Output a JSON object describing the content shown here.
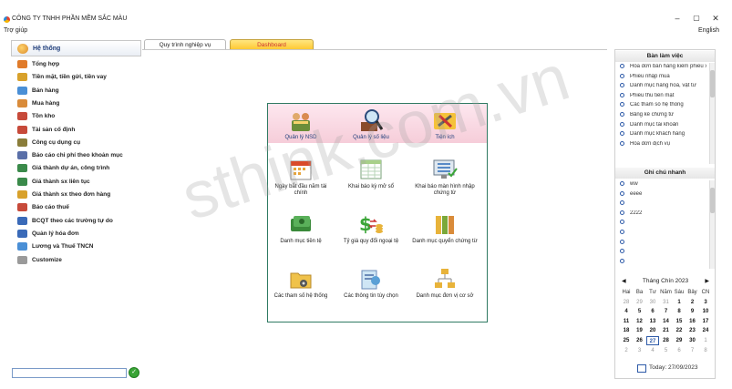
{
  "window": {
    "title": "CÔNG TY TNHH PHẦN MỀM SẮC MÀU",
    "menu_help": "Trợ giúp",
    "language": "English",
    "minimize": "–",
    "maximize": "▢",
    "close": "✕"
  },
  "sidebar": {
    "header": "Hệ thống",
    "items": [
      {
        "label": "Tổng hợp",
        "color": "#e07b2a"
      },
      {
        "label": "Tiền mặt, tiền gửi, tiền vay",
        "color": "#d8a12b"
      },
      {
        "label": "Bán hàng",
        "color": "#4a8fd6"
      },
      {
        "label": "Mua hàng",
        "color": "#d98b3a"
      },
      {
        "label": "Tồn kho",
        "color": "#c74a3a"
      },
      {
        "label": "Tài sản cố định",
        "color": "#c74a3a"
      },
      {
        "label": "Công cụ dụng cụ",
        "color": "#8a7d3a"
      },
      {
        "label": "Báo cáo chi phí theo khoản mục",
        "color": "#5a6fa8"
      },
      {
        "label": "Giá thành dự án, công trình",
        "color": "#3a8a4a"
      },
      {
        "label": "Giá thành sx liên tục",
        "color": "#3a8a4a"
      },
      {
        "label": "Giá thành sx theo đơn hàng",
        "color": "#d8a12b"
      },
      {
        "label": "Báo cáo thuế",
        "color": "#c74a3a"
      },
      {
        "label": "BCQT theo các trường tự do",
        "color": "#3a6ab8"
      },
      {
        "label": "Quản lý hóa đơn",
        "color": "#3a6ab8"
      },
      {
        "label": "Lương và Thuế TNCN",
        "color": "#4a8fd6"
      },
      {
        "label": "Customize",
        "color": "#9a9a9a"
      }
    ],
    "search_value": "",
    "go_icon": "✓"
  },
  "tabs": [
    {
      "label": "Quy trình nghiệp vụ",
      "active": true
    },
    {
      "label": "Dashboard",
      "active": false
    }
  ],
  "workflow": [
    {
      "label": "Quản lý NSD",
      "icon": "users-icon"
    },
    {
      "label": "Quản lý số liệu",
      "icon": "magnifier-icon"
    },
    {
      "label": "Tiện ích",
      "icon": "tools-icon"
    },
    {
      "label": "Ngày bắt đầu năm tài chính",
      "icon": "calendar-icon"
    },
    {
      "label": "Khai báo kỳ mở sổ",
      "icon": "spreadsheet-icon"
    },
    {
      "label": "Khai báo màn hình nhập chứng từ",
      "icon": "monitor-checklist-icon"
    },
    {
      "label": "Danh mục tiền tệ",
      "icon": "money-icon"
    },
    {
      "label": "Tỷ giá quy đổi ngoại tệ",
      "icon": "exchange-rate-icon"
    },
    {
      "label": "Danh mục quyển chứng từ",
      "icon": "binders-icon"
    },
    {
      "label": "Các tham số hệ thống",
      "icon": "folder-gear-icon"
    },
    {
      "label": "Các thông tin tùy chọn",
      "icon": "options-icon"
    },
    {
      "label": "Danh mục đơn vị cơ sở",
      "icon": "network-icon"
    }
  ],
  "right_panel": {
    "desk_title": "Bàn làm việc",
    "desk_items": [
      "Hóa đơn bán hàng kiêm phiếu xuất",
      "Phiếu nhập mua",
      "Danh mục hàng hoá, vật tư",
      "Phiếu thu tiền mặt",
      "Các tham số hệ thống",
      "Bảng kê chứng từ",
      "Danh mục tài khoản",
      "Danh mục khách hàng",
      "Hóa đơn dịch vụ"
    ],
    "notes_title": "Ghi chú nhanh",
    "notes_items": [
      "ww",
      "eeee",
      "",
      "2222",
      "",
      "",
      "",
      "",
      ""
    ]
  },
  "calendar": {
    "month_label": "Tháng Chín 2023",
    "prev": "◀",
    "next": "▶",
    "dow": [
      "Hai",
      "Ba",
      "Tư",
      "Năm",
      "Sáu",
      "Bảy",
      "CN"
    ],
    "weeks": [
      [
        {
          "d": "28",
          "o": 1
        },
        {
          "d": "29",
          "o": 1
        },
        {
          "d": "30",
          "o": 1
        },
        {
          "d": "31",
          "o": 1
        },
        {
          "d": "1"
        },
        {
          "d": "2"
        },
        {
          "d": "3"
        }
      ],
      [
        {
          "d": "4"
        },
        {
          "d": "5"
        },
        {
          "d": "6"
        },
        {
          "d": "7"
        },
        {
          "d": "8"
        },
        {
          "d": "9"
        },
        {
          "d": "10"
        }
      ],
      [
        {
          "d": "11"
        },
        {
          "d": "12"
        },
        {
          "d": "13"
        },
        {
          "d": "14"
        },
        {
          "d": "15"
        },
        {
          "d": "16"
        },
        {
          "d": "17"
        }
      ],
      [
        {
          "d": "18"
        },
        {
          "d": "19"
        },
        {
          "d": "20"
        },
        {
          "d": "21"
        },
        {
          "d": "22"
        },
        {
          "d": "23"
        },
        {
          "d": "24"
        }
      ],
      [
        {
          "d": "25"
        },
        {
          "d": "26"
        },
        {
          "d": "27",
          "t": 1
        },
        {
          "d": "28"
        },
        {
          "d": "29"
        },
        {
          "d": "30"
        },
        {
          "d": "1",
          "o": 1
        }
      ],
      [
        {
          "d": "2",
          "o": 1
        },
        {
          "d": "3",
          "o": 1
        },
        {
          "d": "4",
          "o": 1
        },
        {
          "d": "5",
          "o": 1
        },
        {
          "d": "6",
          "o": 1
        },
        {
          "d": "7",
          "o": 1
        },
        {
          "d": "8",
          "o": 1
        }
      ]
    ],
    "today_label": "Today: 27/09/2023"
  },
  "watermark": "sthink.com.vn"
}
